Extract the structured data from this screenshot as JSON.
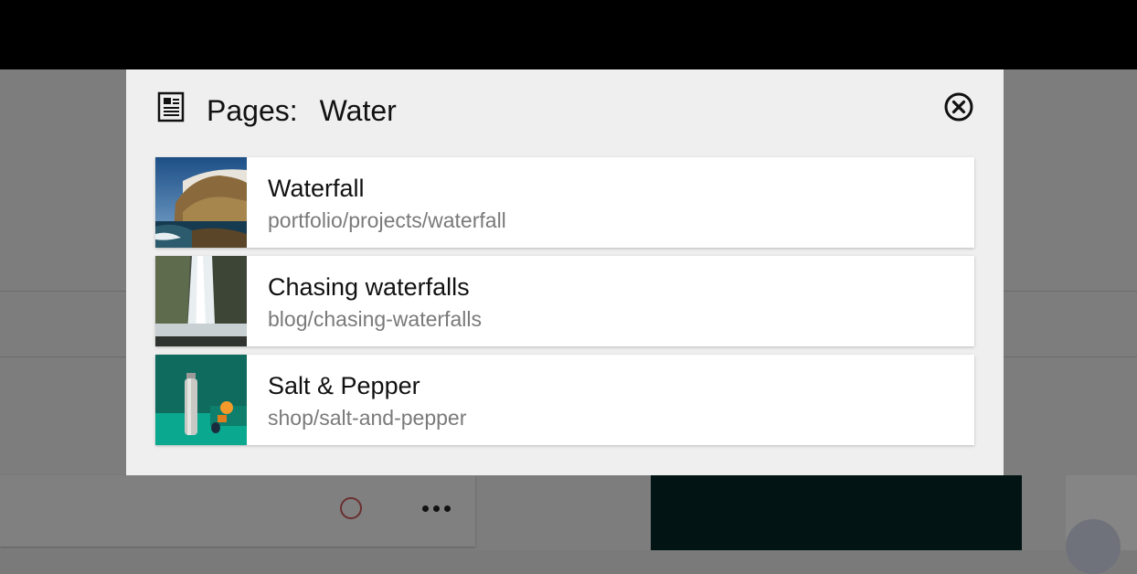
{
  "dialog": {
    "label": "Pages:",
    "query": "Water",
    "icons": {
      "pages": "page-icon",
      "close": "close-icon"
    }
  },
  "results": [
    {
      "title": "Waterfall",
      "path": "portfolio/projects/waterfall",
      "thumbnail": "coastal-cliff-image"
    },
    {
      "title": "Chasing waterfalls",
      "path": "blog/chasing-waterfalls",
      "thumbnail": "waterfall-image"
    },
    {
      "title": "Salt & Pepper",
      "path": "shop/salt-and-pepper",
      "thumbnail": "salt-and-pepper-product-image"
    }
  ],
  "background": {
    "icons": [
      "status-circle-icon",
      "more-options-icon"
    ]
  },
  "colors": {
    "overlay": "#7d7d7d",
    "dialog": "#efefef",
    "card": "#ffffff",
    "path_text": "#7a7a7a"
  }
}
